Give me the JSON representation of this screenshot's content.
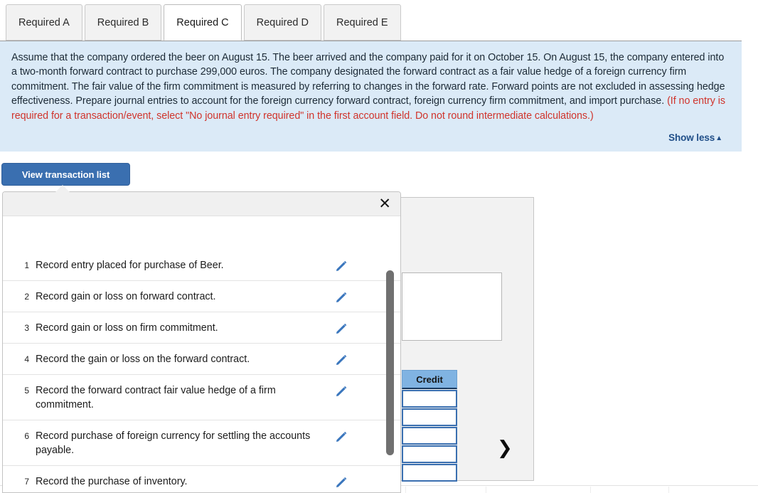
{
  "tabs": [
    {
      "label": "Required A",
      "active": false
    },
    {
      "label": "Required B",
      "active": false
    },
    {
      "label": "Required C",
      "active": true
    },
    {
      "label": "Required D",
      "active": false
    },
    {
      "label": "Required E",
      "active": false
    }
  ],
  "instruction": {
    "body": "Assume that the company ordered the beer on August 15. The beer arrived and the company paid for it on October 15. On August 15, the company entered into a two-month forward contract to purchase 299,000 euros. The company designated the forward contract as a fair value hedge of a foreign currency firm commitment. The fair value of the firm commitment is measured by referring to changes in the forward rate. Forward points are not excluded in assessing hedge effectiveness. Prepare journal entries to account for the foreign currency forward contract, foreign currency firm commitment, and import purchase. ",
    "note": "(If no entry is required for a transaction/event, select \"No journal entry required\" in the first account field. Do not round intermediate calculations.)",
    "show_less_label": "Show less",
    "show_less_caret": "▲"
  },
  "toolbar": {
    "view_transaction_list_label": "View transaction list"
  },
  "modal": {
    "close_label": "✕",
    "transactions": [
      {
        "num": "1",
        "label": "Record entry placed for purchase of Beer."
      },
      {
        "num": "2",
        "label": "Record gain or loss on forward contract."
      },
      {
        "num": "3",
        "label": "Record gain or loss on firm commitment."
      },
      {
        "num": "4",
        "label": "Record the gain or loss on the forward contract."
      },
      {
        "num": "5",
        "label": "Record the forward contract fair value hedge of a firm commitment."
      },
      {
        "num": "6",
        "label": "Record purchase of foreign currency for settling the accounts payable."
      },
      {
        "num": "7",
        "label": "Record the purchase of inventory."
      }
    ]
  },
  "worksheet": {
    "next_chevron": "❯",
    "credit_header": "Credit",
    "credit_rows": [
      "",
      "",
      "",
      "",
      ""
    ]
  },
  "colors": {
    "accent_blue": "#3a6fb0",
    "instruction_bg": "#dbeaf7",
    "note_red": "#d0342c",
    "credit_header_blue": "#80b3e2",
    "scrollbar_gray": "#707070"
  }
}
